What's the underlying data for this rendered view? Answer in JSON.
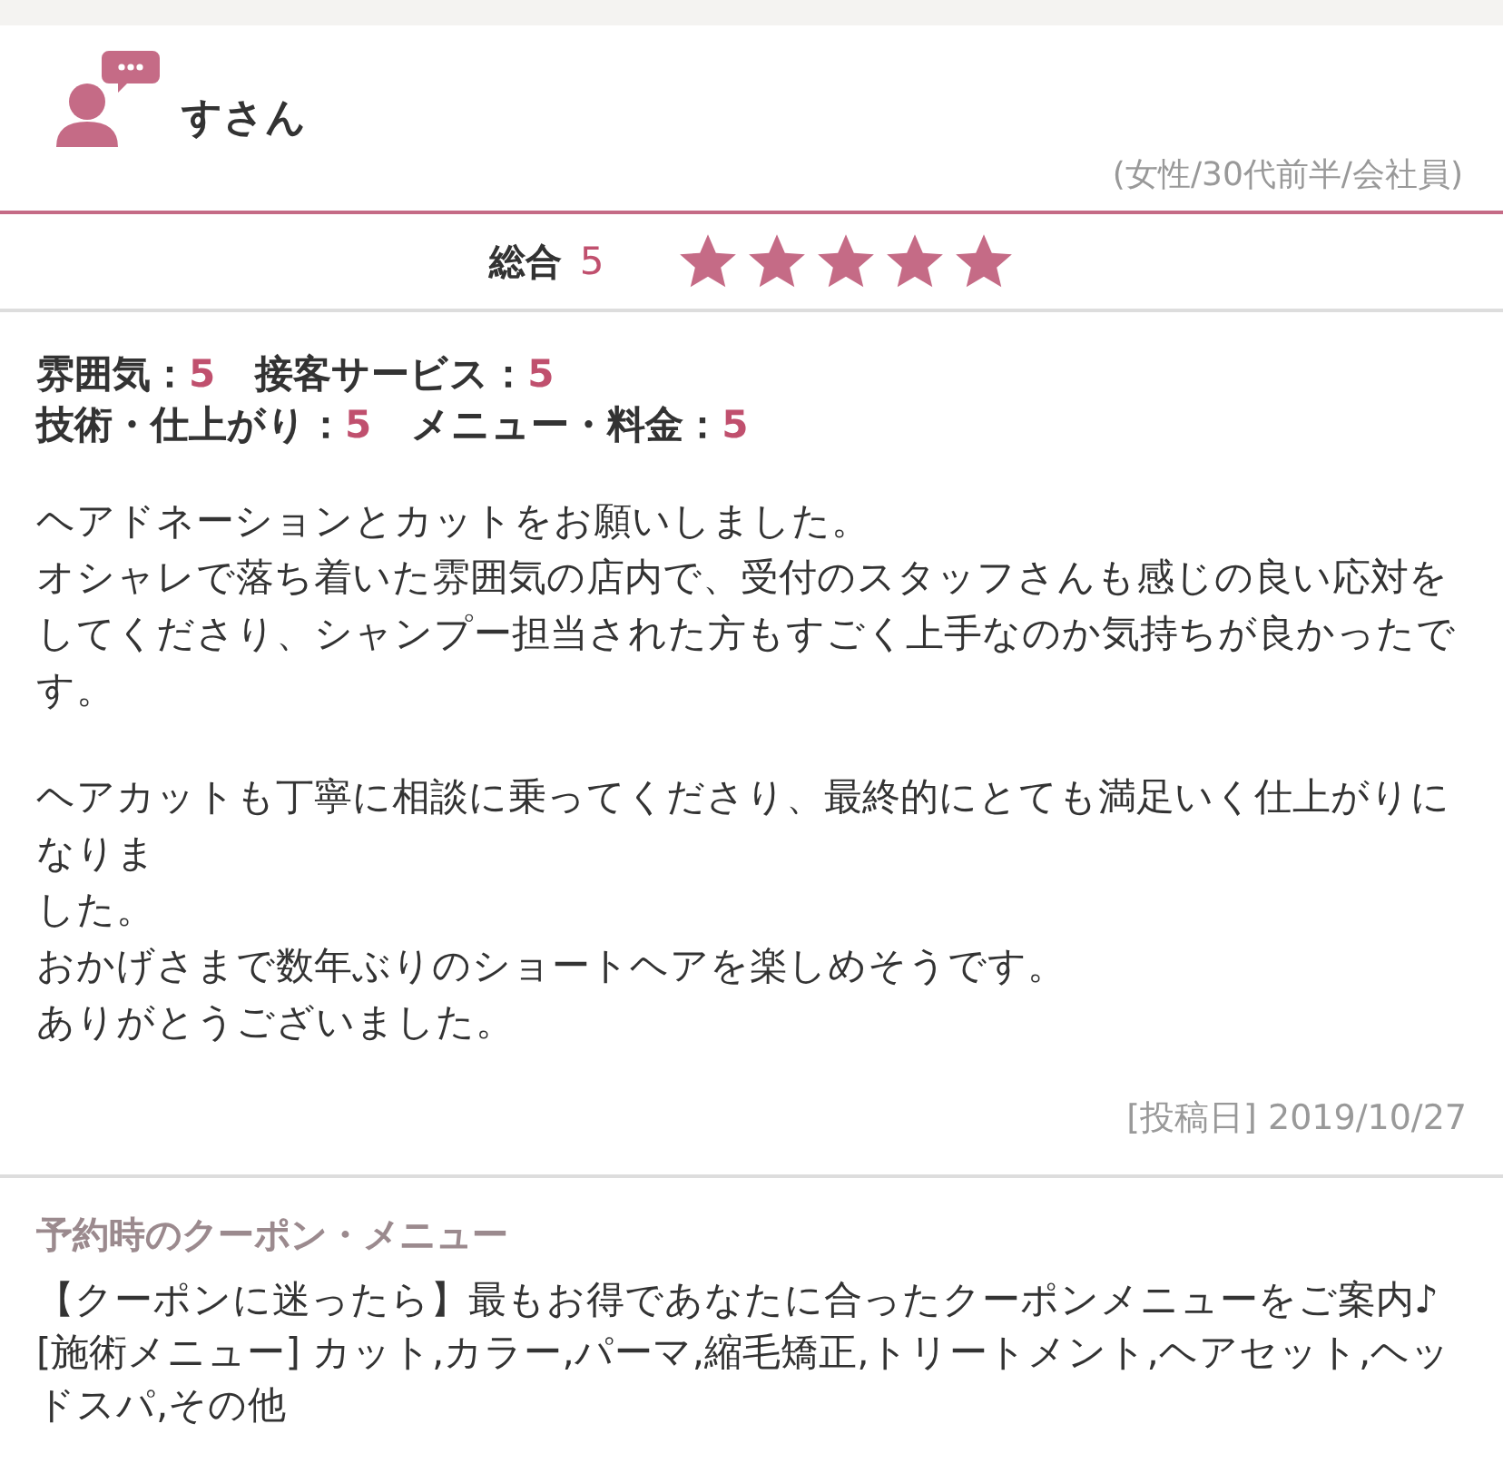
{
  "reviewer": {
    "name": "すさん",
    "profile": "(女性/30代前半/会社員)"
  },
  "overall": {
    "label": "総合",
    "score": "5",
    "stars": 5
  },
  "ratings": [
    [
      {
        "label": "雰囲気：",
        "value": "5"
      },
      {
        "label": "接客サービス：",
        "value": "5"
      }
    ],
    [
      {
        "label": "技術・仕上がり：",
        "value": "5"
      },
      {
        "label": "メニュー・料金：",
        "value": "5"
      }
    ]
  ],
  "review_paragraphs": [
    [
      "ヘアドネーションとカットをお願いしました。",
      "オシャレで落ち着いた雰囲気の店内で、受付のスタッフさんも感じの良い応対をしてくださり、シャンプー担当された方もすごく上手なのか気持ちが良かったです。"
    ],
    [
      "ヘアカットも丁寧に相談に乗ってくださり、最終的にとても満足いく仕上がりになりま",
      "した。",
      "おかげさまで数年ぶりのショートヘアを楽しめそうです。",
      "ありがとうございました。"
    ]
  ],
  "posted": "[投稿日] 2019/10/27",
  "coupon": {
    "heading": "予約時のクーポン・メニュー",
    "lines": [
      "【クーポンに迷ったら】最もお得であなたに合ったクーポンメニューをご案内♪",
      "[施術メニュー] カット,カラー,パーマ,縮毛矯正,トリートメント,ヘアセット,ヘッドスパ,その他"
    ]
  }
}
